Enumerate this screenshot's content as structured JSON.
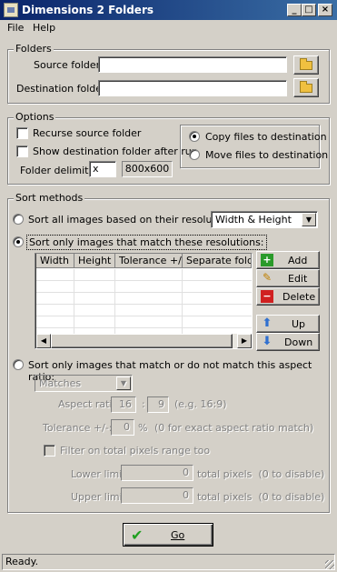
{
  "window": {
    "title": "Dimensions 2 Folders",
    "minimize": "_",
    "maximize": "□",
    "close": "×"
  },
  "menu": {
    "file": "File",
    "help": "Help"
  },
  "folders": {
    "group_label": "Folders",
    "source_label": "Source folder:",
    "source_value": "",
    "destination_label": "Destination folder:",
    "destination_value": ""
  },
  "options": {
    "group_label": "Options",
    "recurse_label": "Recurse source folder",
    "recurse_checked": false,
    "show_dest_label": "Show destination folder after run",
    "show_dest_checked": false,
    "delimiter_label": "Folder delimiter:",
    "delimiter_value": "x",
    "delimiter_preview": "800x600",
    "copy_label": "Copy files to destination",
    "move_label": "Move files to destination",
    "mode_selected": "copy"
  },
  "sort": {
    "group_label": "Sort methods",
    "all_label": "Sort all images based on their resolutions:",
    "all_combo_value": "Width & Height",
    "only_label": "Sort only images that match these resolutions:",
    "selected_method": "only",
    "table_columns": [
      "Width",
      "Height",
      "Tolerance +/-",
      "Separate folde"
    ],
    "table_rows": [],
    "buttons": {
      "add": "Add",
      "edit": "Edit",
      "delete": "Delete",
      "up": "Up",
      "down": "Down"
    },
    "aspect_label": "Sort only images that match or do not match this aspect ratio:",
    "aspect_combo_value": "Matches",
    "aspect_ratio_label": "Aspect ratio:",
    "aspect_w": "16",
    "aspect_sep": ":",
    "aspect_h": "9",
    "aspect_hint": "(e.g. 16:9)",
    "tolerance_label": "Tolerance +/-:",
    "tolerance_value": "0",
    "tolerance_unit": "%",
    "tolerance_hint": "(0 for exact aspect ratio match)",
    "filter_label": "Filter on total pixels range too",
    "lower_label": "Lower limit:",
    "lower_value": "0",
    "upper_label": "Upper limit:",
    "upper_value": "0",
    "pixels_hint": "total pixels  (0 to disable)"
  },
  "go_button": "Go",
  "status": "Ready.",
  "icons": [
    "app-icon",
    "folder-icon",
    "plus-icon",
    "pencil-icon",
    "minus-icon",
    "arrow-up-icon",
    "arrow-down-icon",
    "checkmark-icon"
  ],
  "colors": {
    "titlebar_start": "#0a246a",
    "titlebar_end": "#3a6ea5",
    "face": "#d4d0c8",
    "add_green": "#2a9a2a",
    "delete_red": "#d02020",
    "arrow_blue": "#3070d0",
    "check_green": "#20a020"
  }
}
